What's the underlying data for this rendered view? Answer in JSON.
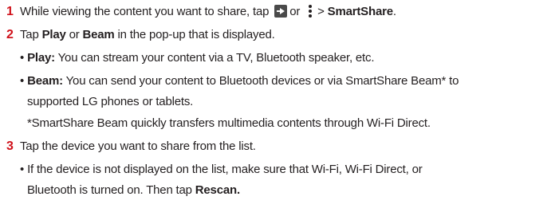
{
  "steps": [
    {
      "number": "1",
      "line1_pre": "While viewing the content you want to share, tap",
      "line1_or": "or",
      "line1_gt": ">",
      "line1_bold": "SmartShare",
      "line1_end": "."
    },
    {
      "number": "2",
      "pre": "Tap",
      "bold1": "Play",
      "mid": "or",
      "bold2": "Beam",
      "post": "in the pop-up that is displayed.",
      "bullets": [
        {
          "bullet": "•",
          "term": "Play:",
          "text": "You can stream your content via a TV, Bluetooth speaker, etc."
        },
        {
          "bullet": "•",
          "term": "Beam:",
          "text_line1": "You can send your content to Bluetooth devices or via SmartShare Beam* to",
          "text_line2": "supported LG phones or tablets."
        }
      ],
      "footnote": "*SmartShare Beam quickly transfers multimedia contents through Wi-Fi Direct."
    },
    {
      "number": "3",
      "text": "Tap the device you want to share from the list.",
      "bullet": "•",
      "note_line1": "If the device is not displayed on the list, make sure that Wi-Fi, Wi-Fi Direct, or",
      "note_line2_pre": "Bluetooth is turned on. Then tap",
      "note_line2_bold": "Rescan."
    }
  ],
  "icons": {
    "share": "share-icon",
    "menu": "menu-dots-icon"
  },
  "colors": {
    "step_number": "#d0121b",
    "text": "#231f20"
  }
}
